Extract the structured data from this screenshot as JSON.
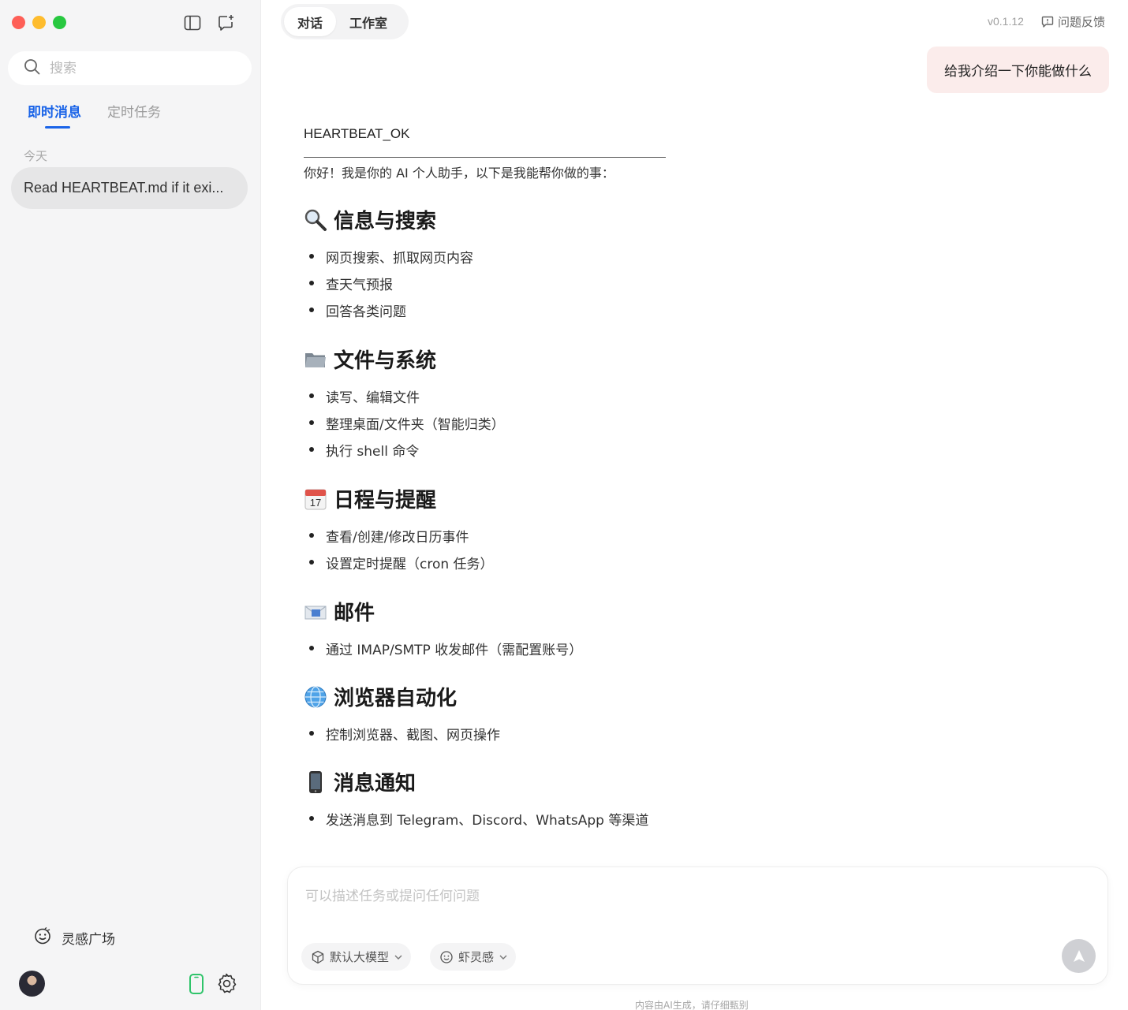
{
  "sidebar": {
    "search_placeholder": "搜索",
    "tabs": [
      {
        "label": "即时消息",
        "active": true
      },
      {
        "label": "定时任务",
        "active": false
      }
    ],
    "group_label": "今天",
    "conversations": [
      {
        "title": "Read HEARTBEAT.md if it exi..."
      }
    ],
    "inspiration_label": "灵感广场"
  },
  "header": {
    "tabs": [
      {
        "label": "对话",
        "active": true
      },
      {
        "label": "工作室",
        "active": false
      }
    ],
    "version": "v0.1.12",
    "feedback_label": "问题反馈"
  },
  "chat": {
    "user_message": "给我介绍一下你能做什么",
    "reply": {
      "status_line": "HEARTBEAT_OK",
      "intro": "你好！我是你的 AI 个人助手，以下是我能帮你做的事：",
      "sections": [
        {
          "icon": "magnifier-icon",
          "title": "信息与搜索",
          "items": [
            "网页搜索、抓取网页内容",
            "查天气预报",
            "回答各类问题"
          ]
        },
        {
          "icon": "folder-icon",
          "title": "文件与系统",
          "items": [
            "读写、编辑文件",
            "整理桌面/文件夹（智能归类）",
            "执行 shell 命令"
          ]
        },
        {
          "icon": "calendar-icon",
          "title": "日程与提醒",
          "items": [
            "查看/创建/修改日历事件",
            "设置定时提醒（cron 任务）"
          ],
          "calendar_day": "17"
        },
        {
          "icon": "envelope-icon",
          "title": "邮件",
          "items": [
            "通过 IMAP/SMTP 收发邮件（需配置账号）"
          ]
        },
        {
          "icon": "globe-icon",
          "title": "浏览器自动化",
          "items": [
            "控制浏览器、截图、网页操作"
          ]
        },
        {
          "icon": "mobile-phone-icon",
          "title": "消息通知",
          "items": [
            "发送消息到 Telegram、Discord、WhatsApp 等渠道"
          ]
        }
      ]
    }
  },
  "composer": {
    "placeholder": "可以描述任务或提问任何问题",
    "model_label": "默认大模型",
    "skill_label": "虾灵感"
  },
  "footer": {
    "disclaimer": "内容由AI生成，请仔细甄别"
  },
  "colors": {
    "accent": "#1a64e8",
    "user_bubble": "#fbeceb",
    "sidebar_bg": "#f5f5f6"
  }
}
